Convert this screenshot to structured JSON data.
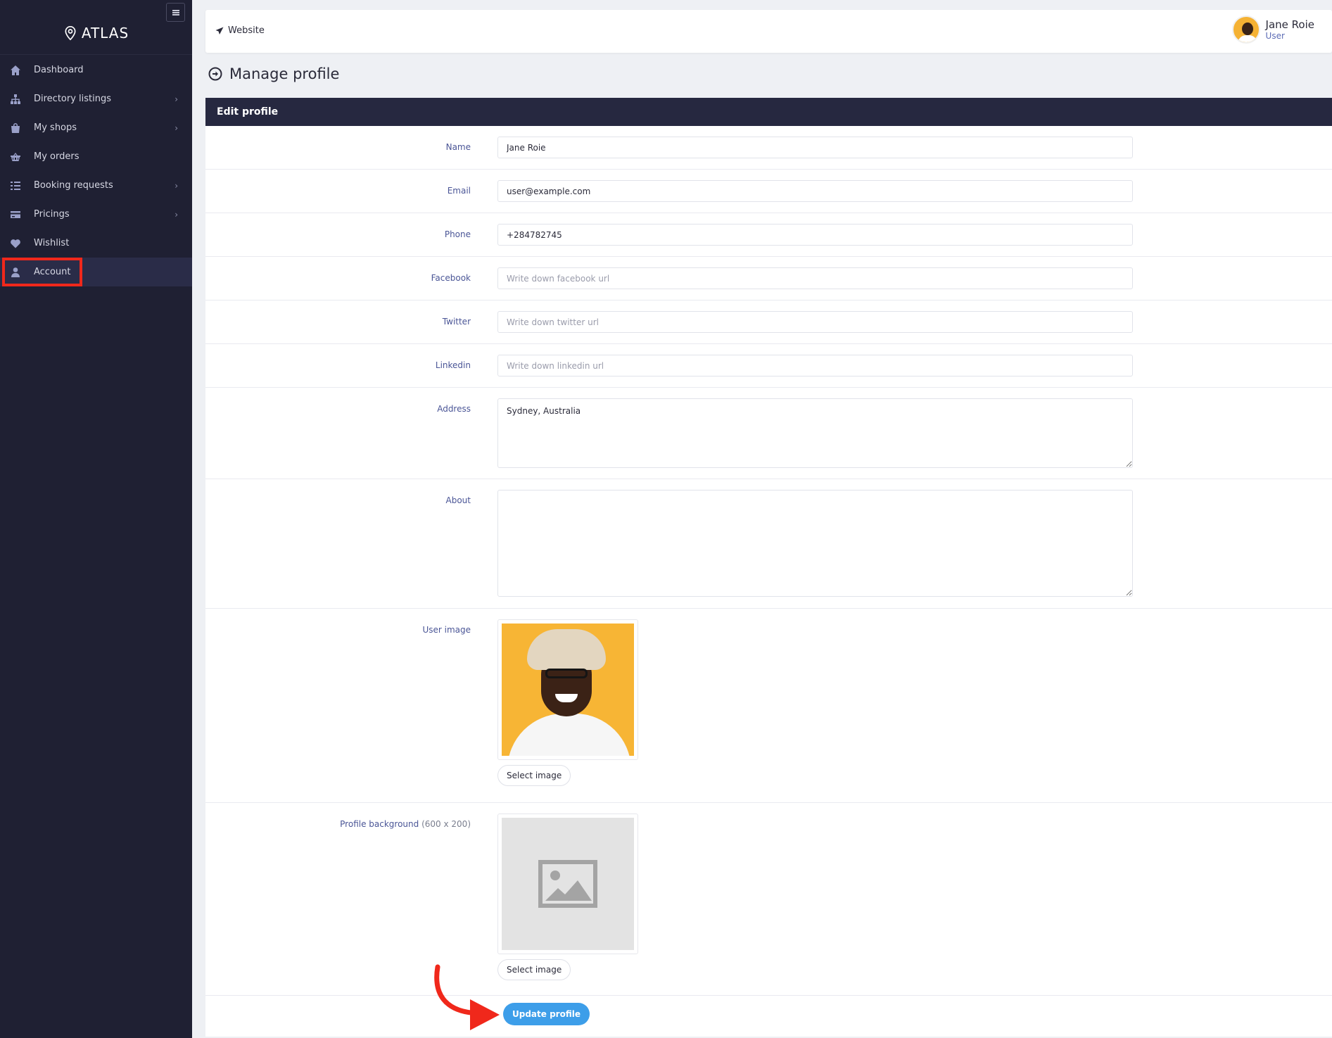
{
  "app": {
    "brand": "ATLAS"
  },
  "sidebar": {
    "items": [
      {
        "label": "Dashboard",
        "icon": "home-icon",
        "has_submenu": false
      },
      {
        "label": "Directory listings",
        "icon": "sitemap-icon",
        "has_submenu": true
      },
      {
        "label": "My shops",
        "icon": "shopping-bag-icon",
        "has_submenu": true
      },
      {
        "label": "My orders",
        "icon": "basket-icon",
        "has_submenu": false
      },
      {
        "label": "Booking requests",
        "icon": "tasks-icon",
        "has_submenu": true
      },
      {
        "label": "Pricings",
        "icon": "credit-card-icon",
        "has_submenu": true
      },
      {
        "label": "Wishlist",
        "icon": "heart-icon",
        "has_submenu": false
      },
      {
        "label": "Account",
        "icon": "user-icon",
        "has_submenu": false,
        "active": true
      }
    ],
    "chevron": "›"
  },
  "topbar": {
    "website_label": "Website",
    "user_name": "Jane Roie",
    "user_role": "User"
  },
  "page": {
    "title": "Manage profile"
  },
  "form": {
    "header": "Edit profile",
    "name": {
      "label": "Name",
      "value": "Jane Roie"
    },
    "email": {
      "label": "Email",
      "value": "user@example.com"
    },
    "phone": {
      "label": "Phone",
      "value": "+284782745"
    },
    "facebook": {
      "label": "Facebook",
      "placeholder": "Write down facebook url"
    },
    "twitter": {
      "label": "Twitter",
      "placeholder": "Write down twitter url"
    },
    "linkedin": {
      "label": "Linkedin",
      "placeholder": "Write down linkedin url"
    },
    "address": {
      "label": "Address",
      "value": "Sydney, Australia"
    },
    "about": {
      "label": "About",
      "value": ""
    },
    "user_image": {
      "label": "User image",
      "button": "Select image"
    },
    "profile_background": {
      "label": "Profile background",
      "hint": "(600 x 200)",
      "button": "Select image"
    },
    "submit": "Update profile"
  },
  "colors": {
    "sidebar_bg": "#1f2033",
    "header_bg": "#262840",
    "accent": "#3d9ee9",
    "highlight": "#f0281b"
  }
}
